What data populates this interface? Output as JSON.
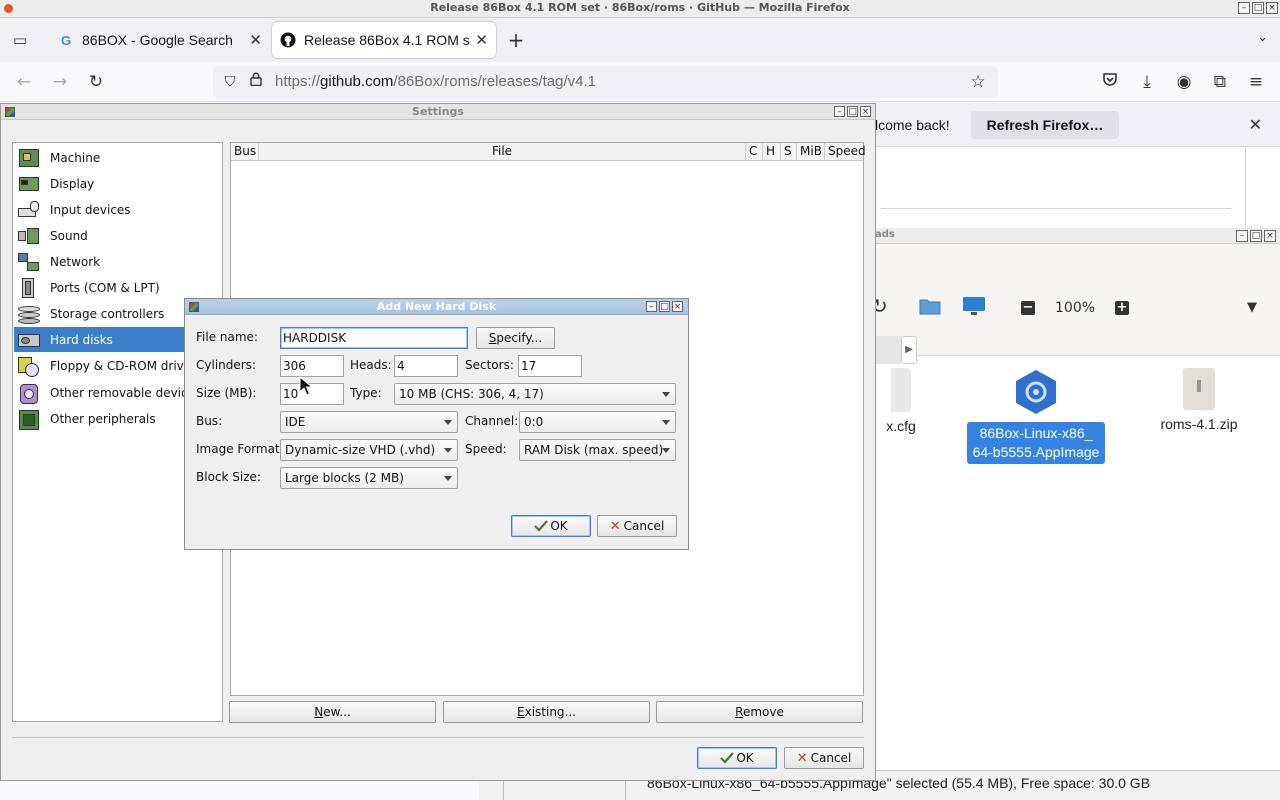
{
  "firefox": {
    "window_title": "Release 86Box 4.1 ROM set · 86Box/roms · GitHub — Mozilla Firefox",
    "tabs": [
      {
        "title": "86BOX - Google Search",
        "favicon": "google-icon"
      },
      {
        "title": "Release 86Box 4.1 ROM s",
        "favicon": "github-icon"
      }
    ],
    "url_host": "github.com",
    "url_prefix": "https://",
    "url_path": "/86Box/roms/releases/tag/v4.1",
    "notification_text": "lcome back!",
    "notification_button": "Refresh Firefox…"
  },
  "file_manager": {
    "title_fragment": "ads",
    "zoom": "100%",
    "files": [
      {
        "name": "x.cfg",
        "selected": false
      },
      {
        "name": "86Box-Linux-x86_64-b5555.AppImage",
        "line1": "86Box-Linux-x86_",
        "line2": "64-b5555.AppImage",
        "selected": true
      },
      {
        "name": "roms-4.1.zip",
        "selected": false
      }
    ],
    "status": "86Box-Linux-x86_64-b5555.AppImage\" selected (55.4 MB), Free space: 30.0 GB"
  },
  "settings": {
    "title": "Settings",
    "categories": [
      {
        "label": "Machine",
        "icon": "machine-icon"
      },
      {
        "label": "Display",
        "icon": "display-icon"
      },
      {
        "label": "Input devices",
        "icon": "input-devices-icon"
      },
      {
        "label": "Sound",
        "icon": "sound-icon"
      },
      {
        "label": "Network",
        "icon": "network-icon"
      },
      {
        "label": "Ports (COM & LPT)",
        "icon": "ports-icon"
      },
      {
        "label": "Storage controllers",
        "icon": "storage-icon"
      },
      {
        "label": "Hard disks",
        "icon": "hard-disk-icon"
      },
      {
        "label": "Floppy & CD-ROM drives",
        "icon": "floppy-cdrom-icon"
      },
      {
        "label": "Other removable devices",
        "icon": "removable-icon"
      },
      {
        "label": "Other peripherals",
        "icon": "peripherals-icon"
      }
    ],
    "selected_category": "Hard disks",
    "columns": [
      "Bus",
      "File",
      "C",
      "H",
      "S",
      "MiB",
      "Speed"
    ],
    "buttons": {
      "new": "New...",
      "existing": "Existing...",
      "remove": "Remove",
      "ok": "OK",
      "cancel": "Cancel"
    }
  },
  "dialog": {
    "title": "Add New Hard Disk",
    "file_name_label": "File name:",
    "file_name": "HARDDISK",
    "specify": "Specify...",
    "cylinders_label": "Cylinders:",
    "cylinders": "306",
    "heads_label": "Heads:",
    "heads": "4",
    "sectors_label": "Sectors:",
    "sectors": "17",
    "size_label": "Size (MB):",
    "size": "10",
    "type_label": "Type:",
    "type": "10 MB (CHS: 306, 4, 17)",
    "bus_label": "Bus:",
    "bus": "IDE",
    "channel_label": "Channel:",
    "channel": "0:0",
    "image_format_label": "Image Format:",
    "image_format": "Dynamic-size VHD (.vhd)",
    "speed_label": "Speed:",
    "speed": "RAM Disk (max. speed)",
    "block_size_label": "Block Size:",
    "block_size": "Large blocks (2 MB)",
    "ok": "OK",
    "cancel": "Cancel"
  }
}
